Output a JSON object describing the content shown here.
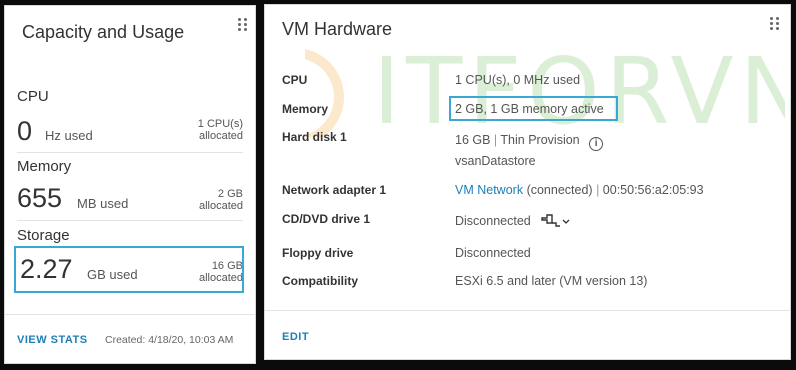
{
  "capacity": {
    "title": "Capacity and Usage",
    "cpu": {
      "label": "CPU",
      "value": "0",
      "unit": "Hz used",
      "alloc_line1": "1 CPU(s)",
      "alloc_line2": "allocated"
    },
    "memory": {
      "label": "Memory",
      "value": "655",
      "unit": "MB used",
      "alloc_line1": "2 GB",
      "alloc_line2": "allocated"
    },
    "storage": {
      "label": "Storage",
      "value": "2.27",
      "unit": "GB used",
      "alloc_line1": "16 GB",
      "alloc_line2": "allocated"
    },
    "footer": {
      "view_stats": "VIEW STATS",
      "created": "Created: 4/18/20, 10:03 AM"
    }
  },
  "vm_hardware": {
    "title": "VM Hardware",
    "rows": {
      "cpu": {
        "label": "CPU",
        "value": "1 CPU(s), 0 MHz used"
      },
      "memory": {
        "label": "Memory",
        "value": "2 GB, 1 GB memory active"
      },
      "hard_disk": {
        "label": "Hard disk 1",
        "size": "16 GB",
        "separator": "|",
        "provision": "Thin Provision",
        "datastore": "vsanDatastore"
      },
      "network": {
        "label": "Network adapter 1",
        "network_link": "VM Network",
        "status": "(connected)",
        "separator": "|",
        "mac": "00:50:56:a2:05:93"
      },
      "cd_dvd": {
        "label": "CD/DVD drive 1",
        "value": "Disconnected"
      },
      "floppy": {
        "label": "Floppy drive",
        "value": "Disconnected"
      },
      "compatibility": {
        "label": "Compatibility",
        "value": "ESXi 6.5 and later (VM version 13)"
      }
    },
    "footer": {
      "edit": "EDIT"
    }
  },
  "watermark": {
    "text": "ITFORVN"
  },
  "colors": {
    "highlight": "#3aa8d6",
    "link": "#1c7fb6",
    "watermark_green": "#5cb847",
    "watermark_orange": "#f39a1e"
  }
}
